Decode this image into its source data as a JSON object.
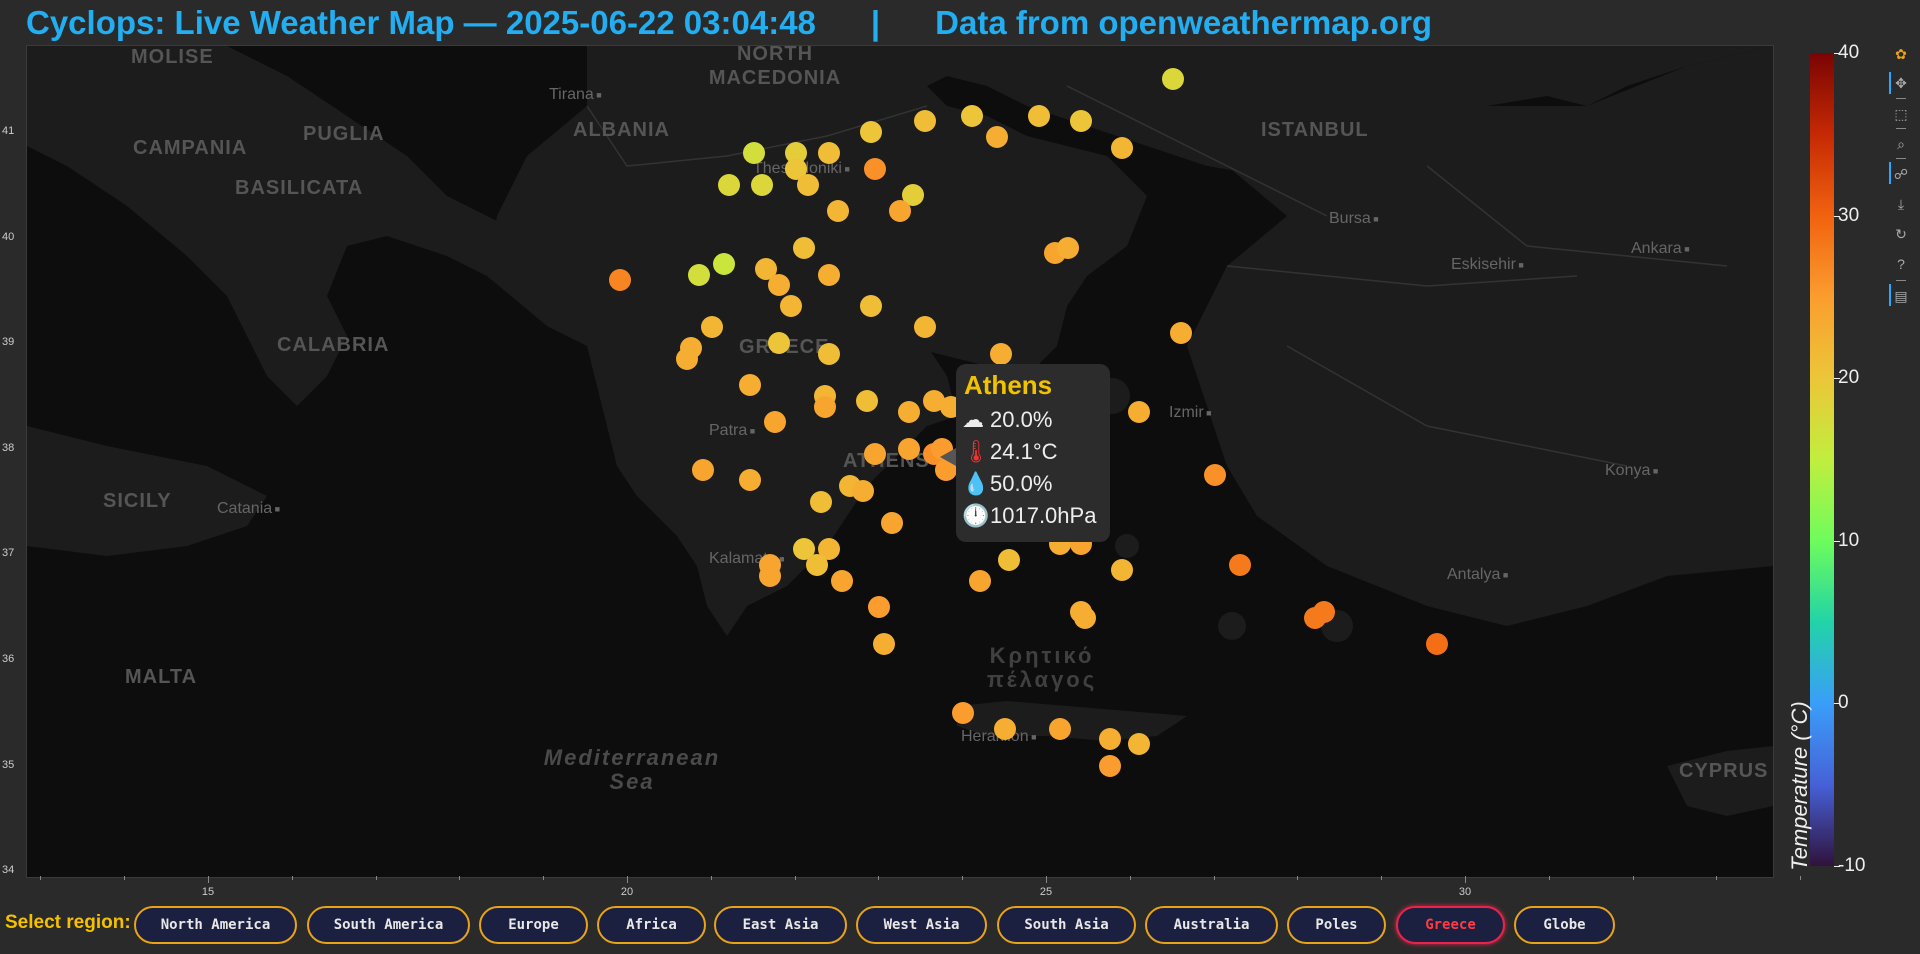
{
  "header": {
    "title": "Cyclops: Live Weather Map — 2025-06-22 03:04:48      |      Data from openweathermap.org"
  },
  "map": {
    "place_labels": [
      "MOLISE",
      "NORTH MACEDONIA",
      "ALBANIA",
      "PUGLIA",
      "CAMPANIA",
      "BASILICATA",
      "CALABRIA",
      "SICILY",
      "MALTA",
      "ISTANBUL",
      "CYPRUS",
      "GREECE",
      "ATHENS"
    ],
    "city_labels": [
      "Tirana",
      "Catania",
      "Patra",
      "Kalamata",
      "Bursa",
      "Eskisehir",
      "Ankara",
      "Izmir",
      "Konya",
      "Antalya",
      "Thessaloniki",
      "Heraklion"
    ],
    "sea_labels": [
      "Mediterranean Sea",
      "Κρητικό πέλαγος"
    ],
    "y_ticks": [
      "41",
      "40",
      "39",
      "38",
      "37",
      "36",
      "35",
      "34"
    ],
    "x_ticks": [
      "15",
      "20",
      "25",
      "30"
    ]
  },
  "tooltip": {
    "city": "Athens",
    "cloud_icon": "cloud-icon",
    "cloud": "20.0%",
    "temp_icon": "thermometer-icon",
    "temp": "24.1°C",
    "humidity_icon": "droplet-icon",
    "humidity": "50.0%",
    "pressure_icon": "gauge-icon",
    "pressure": "1017.0hPa"
  },
  "colorbar": {
    "label": "Temperature (°C)",
    "ticks": [
      "40",
      "30",
      "20",
      "10",
      "0",
      "-10"
    ],
    "range": [
      -10,
      40
    ]
  },
  "toolbar": {
    "tools": [
      "bokeh-logo-icon",
      "pan-icon",
      "box-zoom-icon",
      "wheel-zoom-icon",
      "hover-icon",
      "hover-icon",
      "save-icon",
      "reset-icon",
      "help-icon",
      "comment-icon"
    ]
  },
  "regions": {
    "label": "Select region:",
    "buttons": [
      "North America",
      "South America",
      "Europe",
      "Africa",
      "East Asia",
      "West Asia",
      "South Asia",
      "Australia",
      "Poles",
      "Greece",
      "Globe"
    ],
    "active": "Greece"
  },
  "stations": [
    {
      "lon": 26.5,
      "lat": 41.5,
      "t": 18
    },
    {
      "lon": 21.5,
      "lat": 40.8,
      "t": 17
    },
    {
      "lon": 21.2,
      "lat": 40.5,
      "t": 18
    },
    {
      "lon": 21.6,
      "lat": 40.5,
      "t": 18
    },
    {
      "lon": 22.0,
      "lat": 40.8,
      "t": 19
    },
    {
      "lon": 22.0,
      "lat": 40.65,
      "t": 20
    },
    {
      "lon": 22.15,
      "lat": 40.5,
      "t": 21
    },
    {
      "lon": 22.4,
      "lat": 40.8,
      "t": 21
    },
    {
      "lon": 22.9,
      "lat": 41.0,
      "t": 20
    },
    {
      "lon": 23.55,
      "lat": 41.1,
      "t": 21
    },
    {
      "lon": 24.1,
      "lat": 41.15,
      "t": 20
    },
    {
      "lon": 24.4,
      "lat": 40.95,
      "t": 23
    },
    {
      "lon": 24.9,
      "lat": 41.15,
      "t": 21
    },
    {
      "lon": 25.4,
      "lat": 41.1,
      "t": 20
    },
    {
      "lon": 25.9,
      "lat": 40.85,
      "t": 22
    },
    {
      "lon": 22.95,
      "lat": 40.65,
      "t": 26
    },
    {
      "lon": 23.4,
      "lat": 40.4,
      "t": 19
    },
    {
      "lon": 23.25,
      "lat": 40.25,
      "t": 24
    },
    {
      "lon": 22.5,
      "lat": 40.25,
      "t": 22
    },
    {
      "lon": 22.1,
      "lat": 39.9,
      "t": 21
    },
    {
      "lon": 20.85,
      "lat": 39.65,
      "t": 17
    },
    {
      "lon": 21.15,
      "lat": 39.75,
      "t": 16
    },
    {
      "lon": 21.65,
      "lat": 39.7,
      "t": 22
    },
    {
      "lon": 21.8,
      "lat": 39.55,
      "t": 23
    },
    {
      "lon": 21.95,
      "lat": 39.35,
      "t": 22
    },
    {
      "lon": 22.4,
      "lat": 39.65,
      "t": 23
    },
    {
      "lon": 22.9,
      "lat": 39.35,
      "t": 21
    },
    {
      "lon": 23.55,
      "lat": 39.15,
      "t": 22
    },
    {
      "lon": 19.9,
      "lat": 39.6,
      "t": 27
    },
    {
      "lon": 21.0,
      "lat": 39.15,
      "t": 22
    },
    {
      "lon": 20.75,
      "lat": 38.95,
      "t": 23
    },
    {
      "lon": 20.7,
      "lat": 38.85,
      "t": 23
    },
    {
      "lon": 21.8,
      "lat": 39.0,
      "t": 20
    },
    {
      "lon": 22.4,
      "lat": 38.9,
      "t": 21
    },
    {
      "lon": 24.45,
      "lat": 38.9,
      "t": 23
    },
    {
      "lon": 25.1,
      "lat": 39.85,
      "t": 24
    },
    {
      "lon": 25.25,
      "lat": 39.9,
      "t": 23
    },
    {
      "lon": 26.6,
      "lat": 39.1,
      "t": 23
    },
    {
      "lon": 21.45,
      "lat": 38.6,
      "t": 23
    },
    {
      "lon": 22.35,
      "lat": 38.5,
      "t": 22
    },
    {
      "lon": 22.35,
      "lat": 38.4,
      "t": 24
    },
    {
      "lon": 22.85,
      "lat": 38.45,
      "t": 21
    },
    {
      "lon": 23.35,
      "lat": 38.35,
      "t": 23
    },
    {
      "lon": 23.65,
      "lat": 38.45,
      "t": 23
    },
    {
      "lon": 23.85,
      "lat": 38.4,
      "t": 23
    },
    {
      "lon": 26.1,
      "lat": 38.35,
      "t": 23
    },
    {
      "lon": 21.75,
      "lat": 38.25,
      "t": 24
    },
    {
      "lon": 22.95,
      "lat": 37.95,
      "t": 24
    },
    {
      "lon": 23.35,
      "lat": 38.0,
      "t": 24
    },
    {
      "lon": 23.65,
      "lat": 37.95,
      "t": 26
    },
    {
      "lon": 23.75,
      "lat": 38.0,
      "t": 25
    },
    {
      "lon": 23.8,
      "lat": 37.8,
      "t": 25
    },
    {
      "lon": 20.9,
      "lat": 37.8,
      "t": 24
    },
    {
      "lon": 21.45,
      "lat": 37.7,
      "t": 23
    },
    {
      "lon": 22.3,
      "lat": 37.5,
      "t": 21
    },
    {
      "lon": 22.65,
      "lat": 37.65,
      "t": 22
    },
    {
      "lon": 22.8,
      "lat": 37.6,
      "t": 23
    },
    {
      "lon": 23.15,
      "lat": 37.3,
      "t": 24
    },
    {
      "lon": 27.0,
      "lat": 37.75,
      "t": 26
    },
    {
      "lon": 22.1,
      "lat": 37.05,
      "t": 20
    },
    {
      "lon": 22.4,
      "lat": 37.05,
      "t": 22
    },
    {
      "lon": 22.25,
      "lat": 36.9,
      "t": 21
    },
    {
      "lon": 21.7,
      "lat": 36.9,
      "t": 24
    },
    {
      "lon": 21.7,
      "lat": 36.8,
      "t": 24
    },
    {
      "lon": 22.55,
      "lat": 36.75,
      "t": 24
    },
    {
      "lon": 24.2,
      "lat": 36.75,
      "t": 24
    },
    {
      "lon": 24.55,
      "lat": 36.95,
      "t": 21
    },
    {
      "lon": 25.15,
      "lat": 37.1,
      "t": 23
    },
    {
      "lon": 25.4,
      "lat": 37.1,
      "t": 24
    },
    {
      "lon": 25.9,
      "lat": 36.85,
      "t": 22
    },
    {
      "lon": 27.3,
      "lat": 36.9,
      "t": 28
    },
    {
      "lon": 23.0,
      "lat": 36.5,
      "t": 25
    },
    {
      "lon": 25.4,
      "lat": 36.45,
      "t": 23
    },
    {
      "lon": 25.45,
      "lat": 36.4,
      "t": 23
    },
    {
      "lon": 28.2,
      "lat": 36.4,
      "t": 28
    },
    {
      "lon": 28.3,
      "lat": 36.45,
      "t": 28
    },
    {
      "lon": 29.65,
      "lat": 36.15,
      "t": 29
    },
    {
      "lon": 23.05,
      "lat": 36.15,
      "t": 23
    },
    {
      "lon": 24.0,
      "lat": 35.5,
      "t": 25
    },
    {
      "lon": 24.5,
      "lat": 35.35,
      "t": 23
    },
    {
      "lon": 25.15,
      "lat": 35.35,
      "t": 24
    },
    {
      "lon": 25.75,
      "lat": 35.25,
      "t": 23
    },
    {
      "lon": 26.1,
      "lat": 35.2,
      "t": 22
    },
    {
      "lon": 25.75,
      "lat": 35.0,
      "t": 25
    }
  ]
}
